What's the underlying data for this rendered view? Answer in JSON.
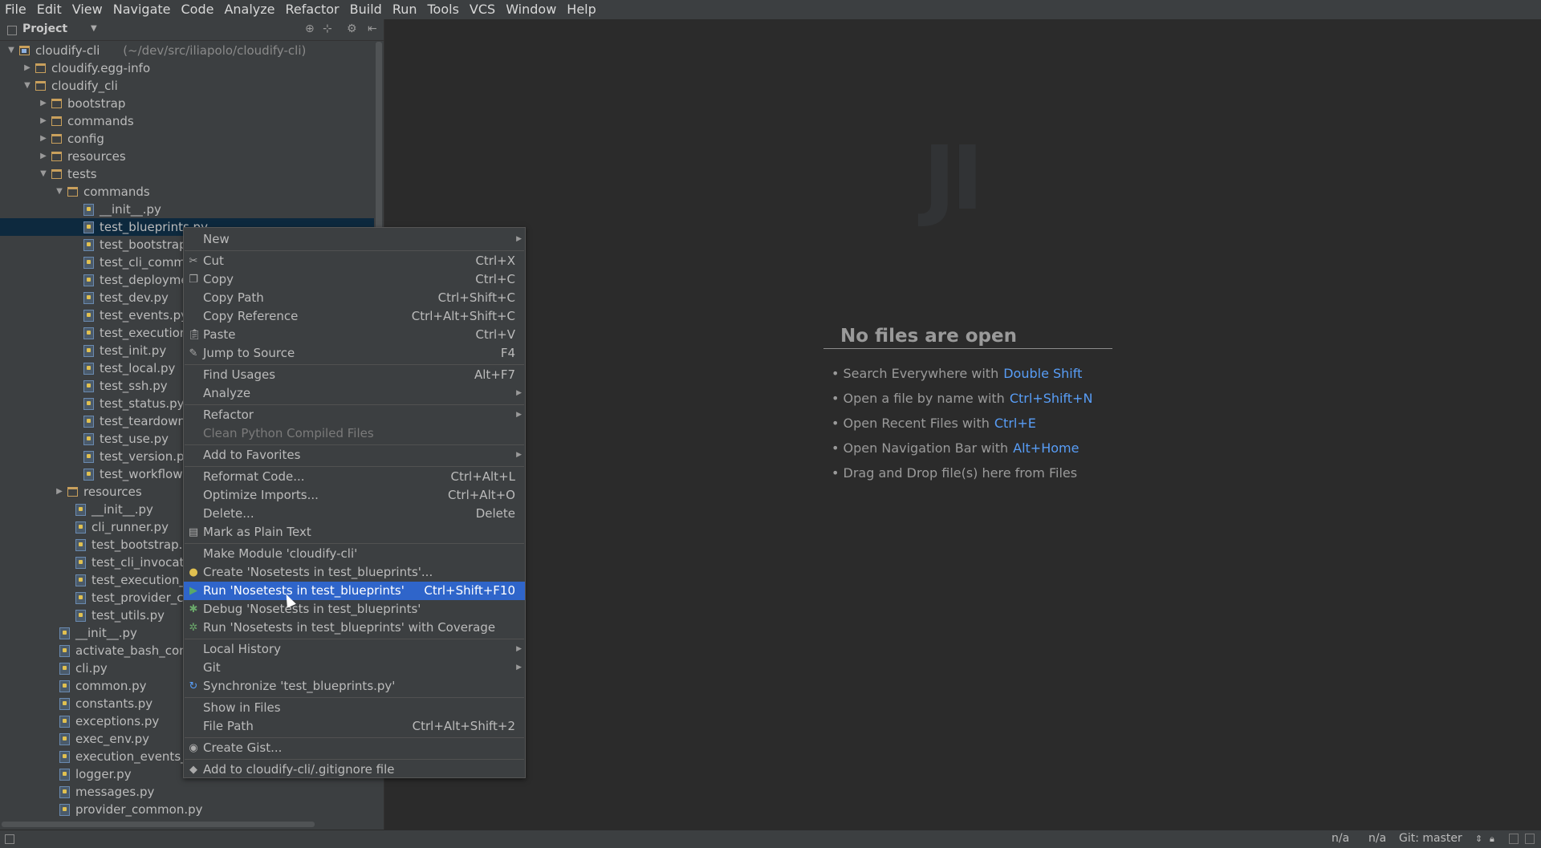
{
  "menubar": [
    "File",
    "Edit",
    "View",
    "Navigate",
    "Code",
    "Analyze",
    "Refactor",
    "Build",
    "Run",
    "Tools",
    "VCS",
    "Window",
    "Help"
  ],
  "project_panel": {
    "title": "Project",
    "tree": [
      {
        "label": "cloudify-cli",
        "path": "(~/dev/src/iliapolo/cloudify-cli)",
        "depth": 0,
        "expanded": true,
        "kind": "module"
      },
      {
        "label": "cloudify.egg-info",
        "depth": 1,
        "expanded": false,
        "kind": "folder"
      },
      {
        "label": "cloudify_cli",
        "depth": 1,
        "expanded": true,
        "kind": "folder"
      },
      {
        "label": "bootstrap",
        "depth": 2,
        "expanded": false,
        "kind": "folder"
      },
      {
        "label": "commands",
        "depth": 2,
        "expanded": false,
        "kind": "folder"
      },
      {
        "label": "config",
        "depth": 2,
        "expanded": false,
        "kind": "folder"
      },
      {
        "label": "resources",
        "depth": 2,
        "expanded": false,
        "kind": "folder"
      },
      {
        "label": "tests",
        "depth": 2,
        "expanded": true,
        "kind": "folder"
      },
      {
        "label": "commands",
        "depth": 3,
        "expanded": true,
        "kind": "folder"
      },
      {
        "label": "__init__.py",
        "depth": 4,
        "kind": "py"
      },
      {
        "label": "test_blueprints.py",
        "depth": 4,
        "kind": "py",
        "selected": true
      },
      {
        "label": "test_bootstrap",
        "depth": 4,
        "kind": "py"
      },
      {
        "label": "test_cli_comma",
        "depth": 4,
        "kind": "py"
      },
      {
        "label": "test_deployme",
        "depth": 4,
        "kind": "py"
      },
      {
        "label": "test_dev.py",
        "depth": 4,
        "kind": "py"
      },
      {
        "label": "test_events.py",
        "depth": 4,
        "kind": "py"
      },
      {
        "label": "test_executior",
        "depth": 4,
        "kind": "py"
      },
      {
        "label": "test_init.py",
        "depth": 4,
        "kind": "py"
      },
      {
        "label": "test_local.py",
        "depth": 4,
        "kind": "py"
      },
      {
        "label": "test_ssh.py",
        "depth": 4,
        "kind": "py"
      },
      {
        "label": "test_status.py",
        "depth": 4,
        "kind": "py"
      },
      {
        "label": "test_teardown",
        "depth": 4,
        "kind": "py"
      },
      {
        "label": "test_use.py",
        "depth": 4,
        "kind": "py"
      },
      {
        "label": "test_version.p",
        "depth": 4,
        "kind": "py"
      },
      {
        "label": "test_workflows",
        "depth": 4,
        "kind": "py"
      },
      {
        "label": "resources",
        "depth": 3,
        "expanded": false,
        "kind": "folder"
      },
      {
        "label": "__init__.py",
        "depth": 3.5,
        "kind": "py"
      },
      {
        "label": "cli_runner.py",
        "depth": 3.5,
        "kind": "py"
      },
      {
        "label": "test_bootstrap.py",
        "depth": 3.5,
        "kind": "py"
      },
      {
        "label": "test_cli_invocati",
        "depth": 3.5,
        "kind": "py"
      },
      {
        "label": "test_execution_e",
        "depth": 3.5,
        "kind": "py"
      },
      {
        "label": "test_provider_co",
        "depth": 3.5,
        "kind": "py"
      },
      {
        "label": "test_utils.py",
        "depth": 3.5,
        "kind": "py"
      },
      {
        "label": "__init__.py",
        "depth": 2.5,
        "kind": "py"
      },
      {
        "label": "activate_bash_comp",
        "depth": 2.5,
        "kind": "py"
      },
      {
        "label": "cli.py",
        "depth": 2.5,
        "kind": "py"
      },
      {
        "label": "common.py",
        "depth": 2.5,
        "kind": "py"
      },
      {
        "label": "constants.py",
        "depth": 2.5,
        "kind": "py"
      },
      {
        "label": "exceptions.py",
        "depth": 2.5,
        "kind": "py"
      },
      {
        "label": "exec_env.py",
        "depth": 2.5,
        "kind": "py"
      },
      {
        "label": "execution_events_f",
        "depth": 2.5,
        "kind": "py"
      },
      {
        "label": "logger.py",
        "depth": 2.5,
        "kind": "py"
      },
      {
        "label": "messages.py",
        "depth": 2.5,
        "kind": "py"
      },
      {
        "label": "provider_common.py",
        "depth": 2.5,
        "kind": "py"
      }
    ]
  },
  "context_menu": [
    {
      "label": "New",
      "submenu": true
    },
    {
      "sep": true
    },
    {
      "label": "Cut",
      "shortcut": "Ctrl+X",
      "icon": "cut"
    },
    {
      "label": "Copy",
      "shortcut": "Ctrl+C",
      "icon": "copy"
    },
    {
      "label": "Copy Path",
      "shortcut": "Ctrl+Shift+C"
    },
    {
      "label": "Copy Reference",
      "shortcut": "Ctrl+Alt+Shift+C"
    },
    {
      "label": "Paste",
      "shortcut": "Ctrl+V",
      "icon": "paste"
    },
    {
      "label": "Jump to Source",
      "shortcut": "F4",
      "icon": "jump"
    },
    {
      "sep": true
    },
    {
      "label": "Find Usages",
      "shortcut": "Alt+F7"
    },
    {
      "label": "Analyze",
      "submenu": true
    },
    {
      "sep": true
    },
    {
      "label": "Refactor",
      "submenu": true
    },
    {
      "label": "Clean Python Compiled Files",
      "disabled": true
    },
    {
      "sep": true
    },
    {
      "label": "Add to Favorites",
      "submenu": true
    },
    {
      "sep": true
    },
    {
      "label": "Reformat Code...",
      "shortcut": "Ctrl+Alt+L"
    },
    {
      "label": "Optimize Imports...",
      "shortcut": "Ctrl+Alt+O"
    },
    {
      "label": "Delete...",
      "shortcut": "Delete"
    },
    {
      "label": "Mark as Plain Text",
      "icon": "plain"
    },
    {
      "sep": true
    },
    {
      "label": "Make Module 'cloudify-cli'"
    },
    {
      "label": "Create 'Nosetests in test_blueprints'...",
      "icon": "python"
    },
    {
      "label": "Run 'Nosetests in test_blueprints'",
      "shortcut": "Ctrl+Shift+F10",
      "icon": "run",
      "highlighted": true
    },
    {
      "label": "Debug 'Nosetests in test_blueprints'",
      "icon": "debug"
    },
    {
      "label": "Run 'Nosetests in test_blueprints' with Coverage",
      "icon": "coverage"
    },
    {
      "sep": true
    },
    {
      "label": "Local History",
      "submenu": true
    },
    {
      "label": "Git",
      "submenu": true
    },
    {
      "label": "Synchronize 'test_blueprints.py'",
      "icon": "sync"
    },
    {
      "sep": true
    },
    {
      "label": "Show in Files"
    },
    {
      "label": "File Path",
      "shortcut": "Ctrl+Alt+Shift+2"
    },
    {
      "sep": true
    },
    {
      "label": "Create Gist...",
      "icon": "gist"
    },
    {
      "sep": true
    },
    {
      "label": "Add to cloudify-cli/.gitignore file",
      "icon": "gitignore"
    }
  ],
  "editor": {
    "empty_title": "No files are open",
    "hints": [
      {
        "text": "• Search Everywhere with",
        "key": "Double Shift"
      },
      {
        "text": "• Open a file by name with",
        "key": "Ctrl+Shift+N"
      },
      {
        "text": "• Open Recent Files with",
        "key": "Ctrl+E"
      },
      {
        "text": "• Open Navigation Bar with",
        "key": "Alt+Home"
      },
      {
        "text": "• Drag and Drop file(s) here from Files",
        "key": ""
      }
    ]
  },
  "statusbar": {
    "pos1": "n/a",
    "pos2": "n/a",
    "vcs": "Git: master"
  },
  "colors": {
    "selection": "#2f65ca",
    "accent_key": "#589df6",
    "panel": "#3c3f41",
    "editor": "#2b2b2b"
  }
}
